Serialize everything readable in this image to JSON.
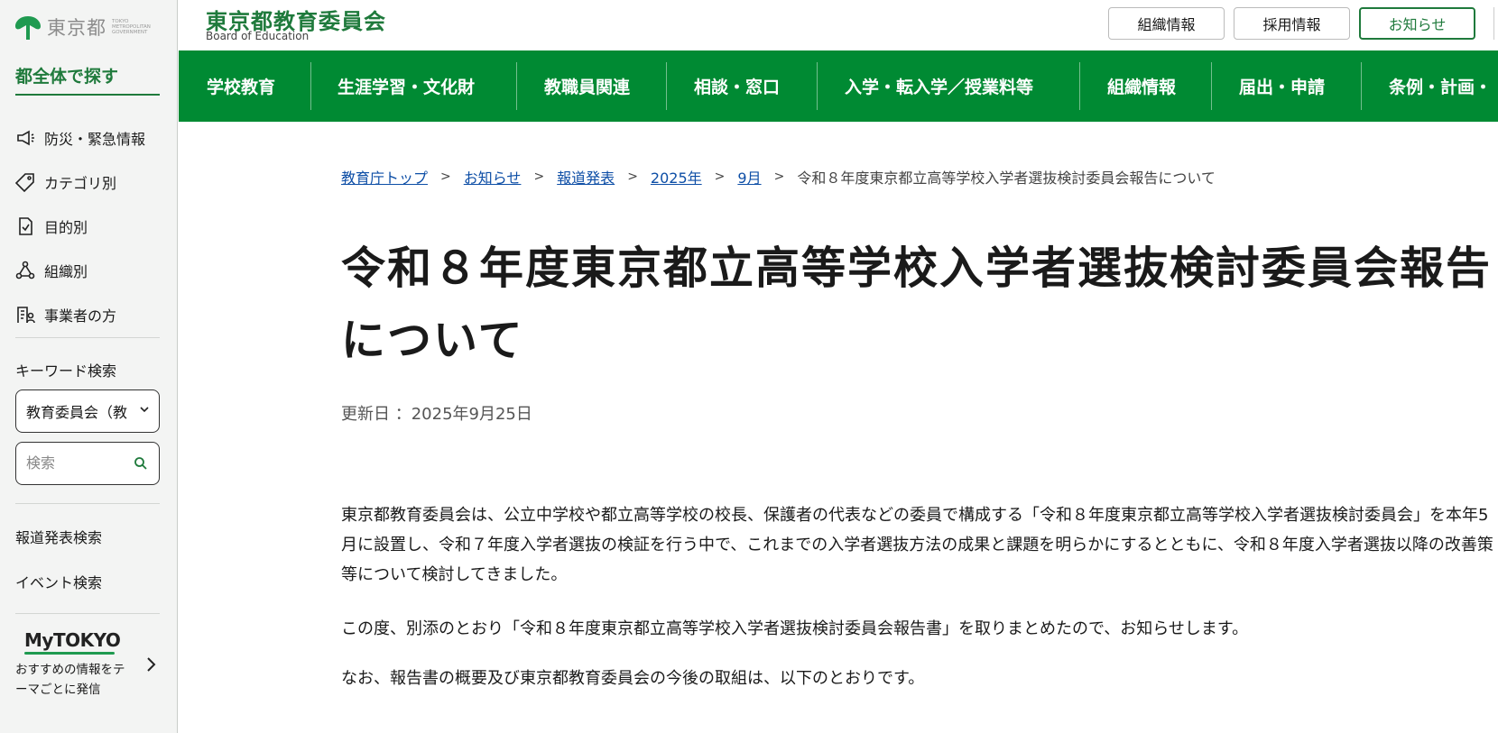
{
  "sidebar": {
    "logo_name": "東京都",
    "logo_en": "TOKYO METROPOLITAN GOVERNMENT",
    "heading": "都全体で探す",
    "nav": [
      {
        "label": "防災・緊急情報",
        "icon": "megaphone-icon"
      },
      {
        "label": "カテゴリ別",
        "icon": "tag-icon"
      },
      {
        "label": "目的別",
        "icon": "checklist-icon"
      },
      {
        "label": "組織別",
        "icon": "organization-icon"
      },
      {
        "label": "事業者の方",
        "icon": "business-icon"
      }
    ],
    "keyword_label": "キーワード検索",
    "select_value": "教育委員会（教",
    "search_placeholder": "検索",
    "press_search": "報道発表検索",
    "event_search": "イベント検索",
    "mytokyo_logo": "MyTOKYO",
    "mytokyo_text": "おすすめの情報をテーマごとに発信"
  },
  "header": {
    "title": "東京都教育委員会",
    "subtitle": "Board of Education",
    "buttons": [
      "組織情報",
      "採用情報",
      "お知らせ"
    ]
  },
  "gnav": [
    "学校教育",
    "生涯学習・文化財",
    "教職員関連",
    "相談・窓口",
    "入学・転入学／授業料等",
    "組織情報",
    "届出・申請",
    "条例・計画・"
  ],
  "breadcrumb": {
    "links": [
      "教育庁トップ",
      "お知らせ",
      "報道発表",
      "2025年",
      "9月"
    ],
    "current": "令和８年度東京都立高等学校入学者選抜検討委員会報告について"
  },
  "main": {
    "title": "令和８年度東京都立高等学校入学者選抜検討委員会報告について",
    "updated": "更新日 ：2025年9月25日",
    "paragraphs": [
      "東京都教育委員会は、公立中学校や都立高等学校の校長、保護者の代表などの委員で構成する「令和８年度東京都立高等学校入学者選抜検討委員会」を本年5月に設置し、令和７年度入学者選抜の検証を行う中で、これまでの入学者選抜方法の成果と課題を明らかにするとともに、令和８年度入学者選抜以降の改善策等について検討してきました。",
      "この度、別添のとおり「令和８年度東京都立高等学校入学者選抜検討委員会報告書」を取りまとめたので、お知らせします。",
      "なお、報告書の概要及び東京都教育委員会の今後の取組は、以下のとおりです。"
    ]
  },
  "colors": {
    "brand_green": "#008a33",
    "text_green": "#1f7a3c",
    "link_blue": "#0d4ea6"
  }
}
